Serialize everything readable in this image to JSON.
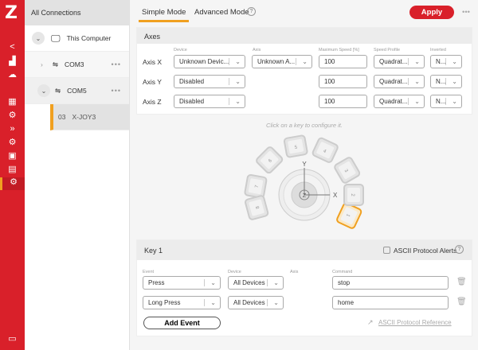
{
  "app": {
    "logo": "Z"
  },
  "rail": {
    "icons": [
      "share-icon",
      "network-icon",
      "cloud-icon",
      "grid-icon",
      "gear-icon",
      "fast-forward-icon",
      "gears-icon",
      "image-icon",
      "chart-icon",
      "joystick-icon"
    ],
    "bottom_icon": "chat-icon"
  },
  "tree": {
    "header": "All Connections",
    "computer": "This Computer",
    "com3": "COM3",
    "com5": "COM5",
    "device_num": "03",
    "device_name": "X-JOY3",
    "more": "•••"
  },
  "tabs": {
    "simple": "Simple Mode",
    "advanced": "Advanced Mode",
    "help": "?",
    "apply": "Apply",
    "more": "•••"
  },
  "colors": {
    "brand": "#d9202a",
    "accent": "#f0a020"
  },
  "axes": {
    "title": "Axes",
    "cols": {
      "device": "Device",
      "axis": "Axis",
      "max": "Maximum Speed [%]",
      "profile": "Speed Profile",
      "inverted": "Inverted"
    },
    "rows": [
      {
        "label": "Axis X",
        "device": "Unknown Devic...",
        "axis": "Unknown A...",
        "max": "100",
        "profile": "Quadrat...",
        "inverted": "N..."
      },
      {
        "label": "Axis Y",
        "device": "Disabled",
        "max": "100",
        "profile": "Quadrat...",
        "inverted": "N..."
      },
      {
        "label": "Axis Z",
        "device": "Disabled",
        "max": "100",
        "profile": "Quadrat...",
        "inverted": "N..."
      }
    ]
  },
  "joystick": {
    "hint": "Click on a key to configure it.",
    "keys": [
      "1",
      "2",
      "3",
      "4",
      "5",
      "6",
      "7",
      "8"
    ],
    "selected_key": "1",
    "y": "Y",
    "x": "X",
    "z": "Z"
  },
  "key": {
    "title": "Key 1",
    "alerts": "ASCII Protocol Alerts",
    "help": "?",
    "cols": {
      "event": "Event",
      "device": "Device",
      "axis": "Axis",
      "command": "Command"
    },
    "rows": [
      {
        "event": "Press",
        "device": "All Devices",
        "command": "stop"
      },
      {
        "event": "Long Press",
        "device": "All Devices",
        "command": "home"
      }
    ],
    "add": "Add Event",
    "ref": "ASCII Protocol Reference"
  }
}
